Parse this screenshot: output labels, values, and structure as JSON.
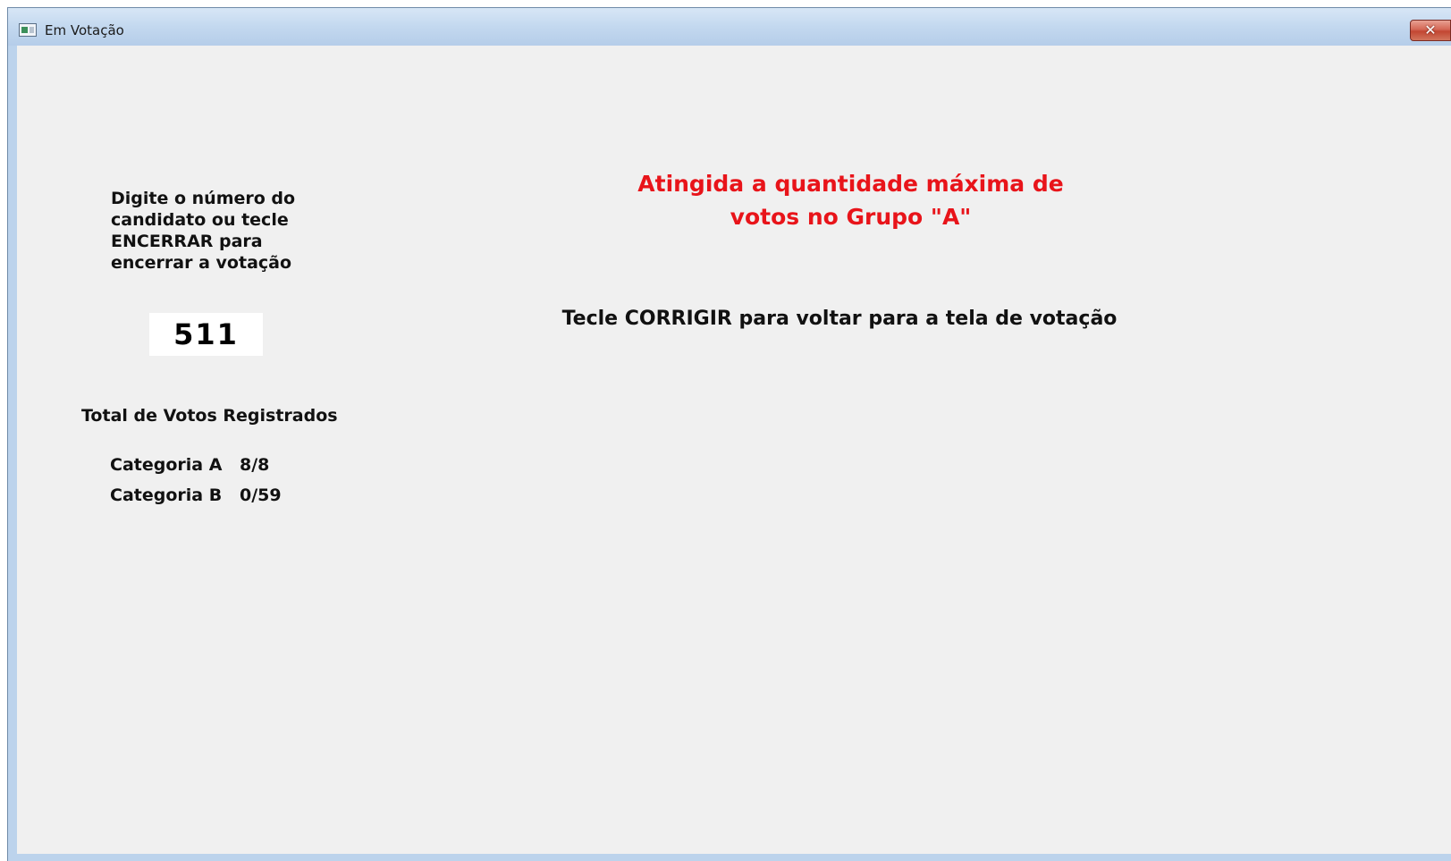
{
  "window": {
    "title": "Em Votação",
    "close_symbol": "✕"
  },
  "left_panel": {
    "instruction": "Digite o número do\ncandidato ou tecle\nENCERRAR para\nencerrar a votação",
    "entered_number": "511",
    "totals_heading": "Total de Votos Registrados",
    "categories": [
      {
        "label": "Categoria A",
        "value": "8/8"
      },
      {
        "label": "Categoria B",
        "value": "0/59"
      }
    ]
  },
  "main": {
    "alert_message": "Atingida a quantidade máxima de\nvotos no Grupo \"A\"",
    "hint_message": "Tecle CORRIGIR para voltar para a tela de votação"
  },
  "colors": {
    "alert": "#e8141a",
    "background": "#f0f0f0",
    "text": "#111111"
  },
  "icons": {
    "app": "application-window-icon",
    "close": "close-icon"
  }
}
